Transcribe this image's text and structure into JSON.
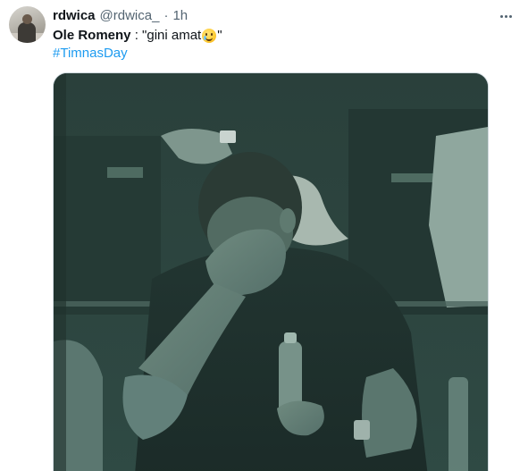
{
  "tweet": {
    "author": {
      "display_name": "rdwica",
      "handle": "@rdwica_",
      "separator": "·",
      "time": "1h"
    },
    "text": {
      "speaker": "Ole Romeny",
      "prefix": " : \"gini amat",
      "suffix": "\""
    },
    "hashtag": "#TimnasDay",
    "icons": {
      "more": "more-horizontal-icon",
      "emoji": "crying-smile-emoji"
    },
    "colors": {
      "text_primary": "#0f1419",
      "text_secondary": "#536471",
      "link": "#1d9bf0",
      "media_tint": "#2c4741"
    }
  }
}
